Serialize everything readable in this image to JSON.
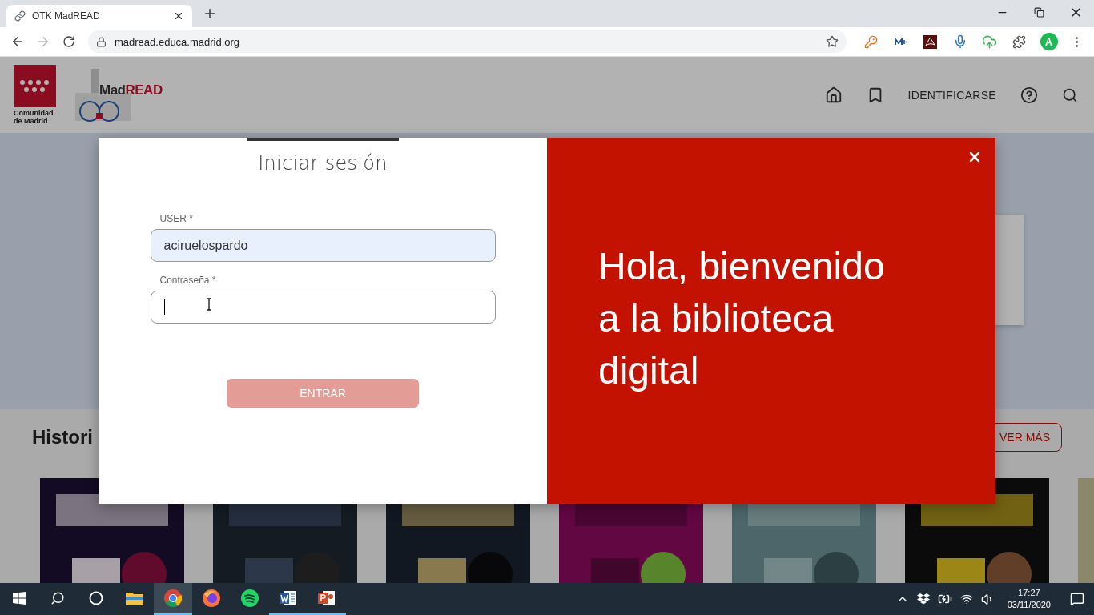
{
  "browser": {
    "tab": {
      "title": "OTK MadREAD"
    },
    "address": "madread.educa.madrid.org",
    "forward_disabled": true,
    "profile_initial": "A"
  },
  "header": {
    "region_name": "Comunidad de Madrid",
    "brand_first": "Mad",
    "brand_second": "READ",
    "nav_label": "IDENTIFICARSE"
  },
  "section": {
    "title": "Histori",
    "more_button": "VER MÁS"
  },
  "login": {
    "title": "Iniciar sesión",
    "fields": [
      {
        "label": "USER *",
        "value": "aciruelospardo",
        "kind": "text",
        "focused": false,
        "autofilled": true
      },
      {
        "label": "Contraseña *",
        "kind": "password",
        "focused": true,
        "autofilled": false
      }
    ],
    "submit": {
      "label": "ENTRAR",
      "disabled": true
    },
    "welcome": "Hola, bienvenido a la biblioteca digital"
  },
  "taskbar": {
    "apps": [
      {
        "kind": "explorer",
        "selected": false,
        "open": false
      },
      {
        "kind": "chrome",
        "selected": true,
        "open": true
      },
      {
        "kind": "firefox",
        "selected": false,
        "open": false
      },
      {
        "kind": "spotify",
        "selected": false,
        "open": false
      },
      {
        "kind": "word",
        "selected": false,
        "open": true
      },
      {
        "kind": "powerpoint",
        "selected": false,
        "open": true
      }
    ],
    "time": "17:27",
    "date": "03/11/2020"
  }
}
